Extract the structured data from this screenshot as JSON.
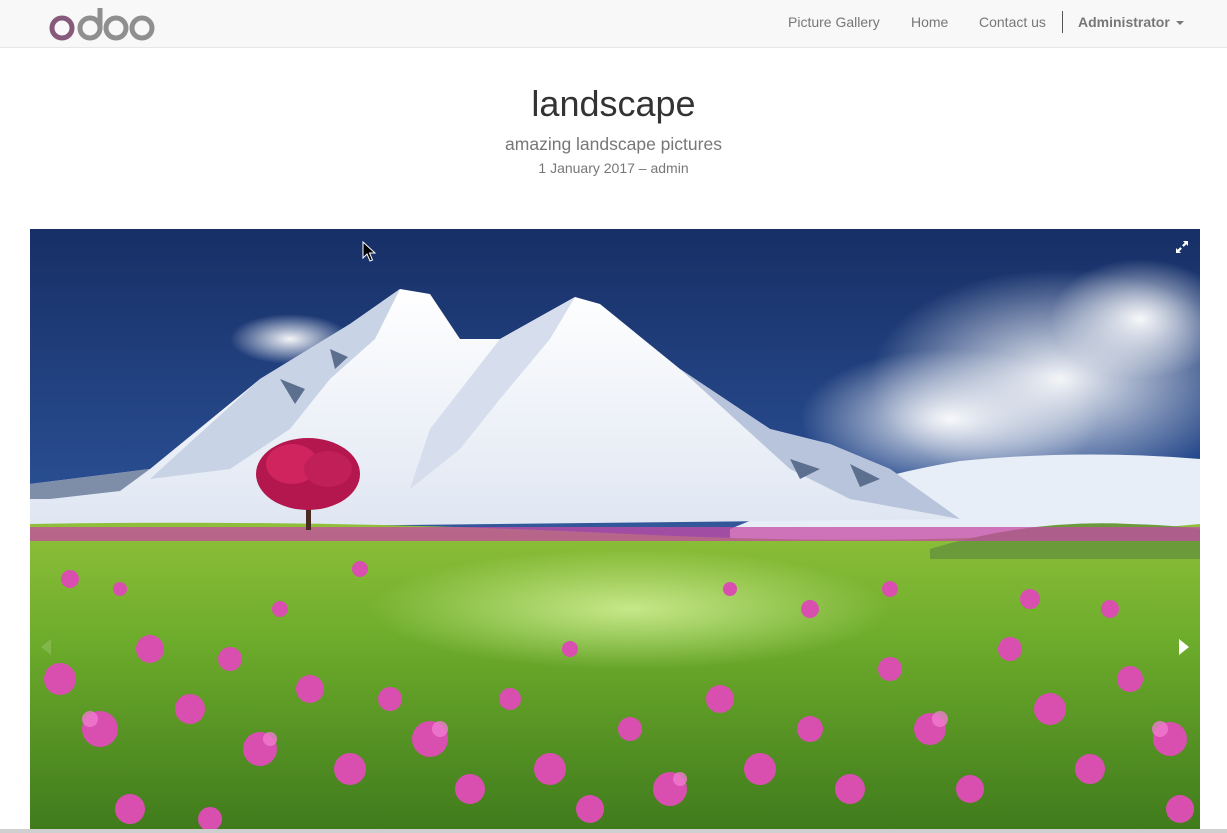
{
  "navbar": {
    "logo_text": "odoo",
    "links": {
      "picture_gallery": "Picture Gallery",
      "home": "Home",
      "contact_us": "Contact us"
    },
    "user_menu": "Administrator"
  },
  "post": {
    "title": "landscape",
    "subtitle": "amazing landscape pictures",
    "meta": "1 January 2017 – admin"
  },
  "gallery": {
    "image_description": "snow-capped mountains above a meadow of pink flowers with a red tree",
    "controls": [
      "expand-icon",
      "next-arrow-icon",
      "prev-arrow-icon"
    ]
  },
  "colors": {
    "logo_purple": "#875a7b",
    "logo_gray": "#8f8f8f",
    "navbar_bg": "#f8f8f8",
    "nav_text": "#777777",
    "sky": "#1d3b78",
    "grass": "#5e9e2a",
    "flowers": "#d94fb0"
  }
}
